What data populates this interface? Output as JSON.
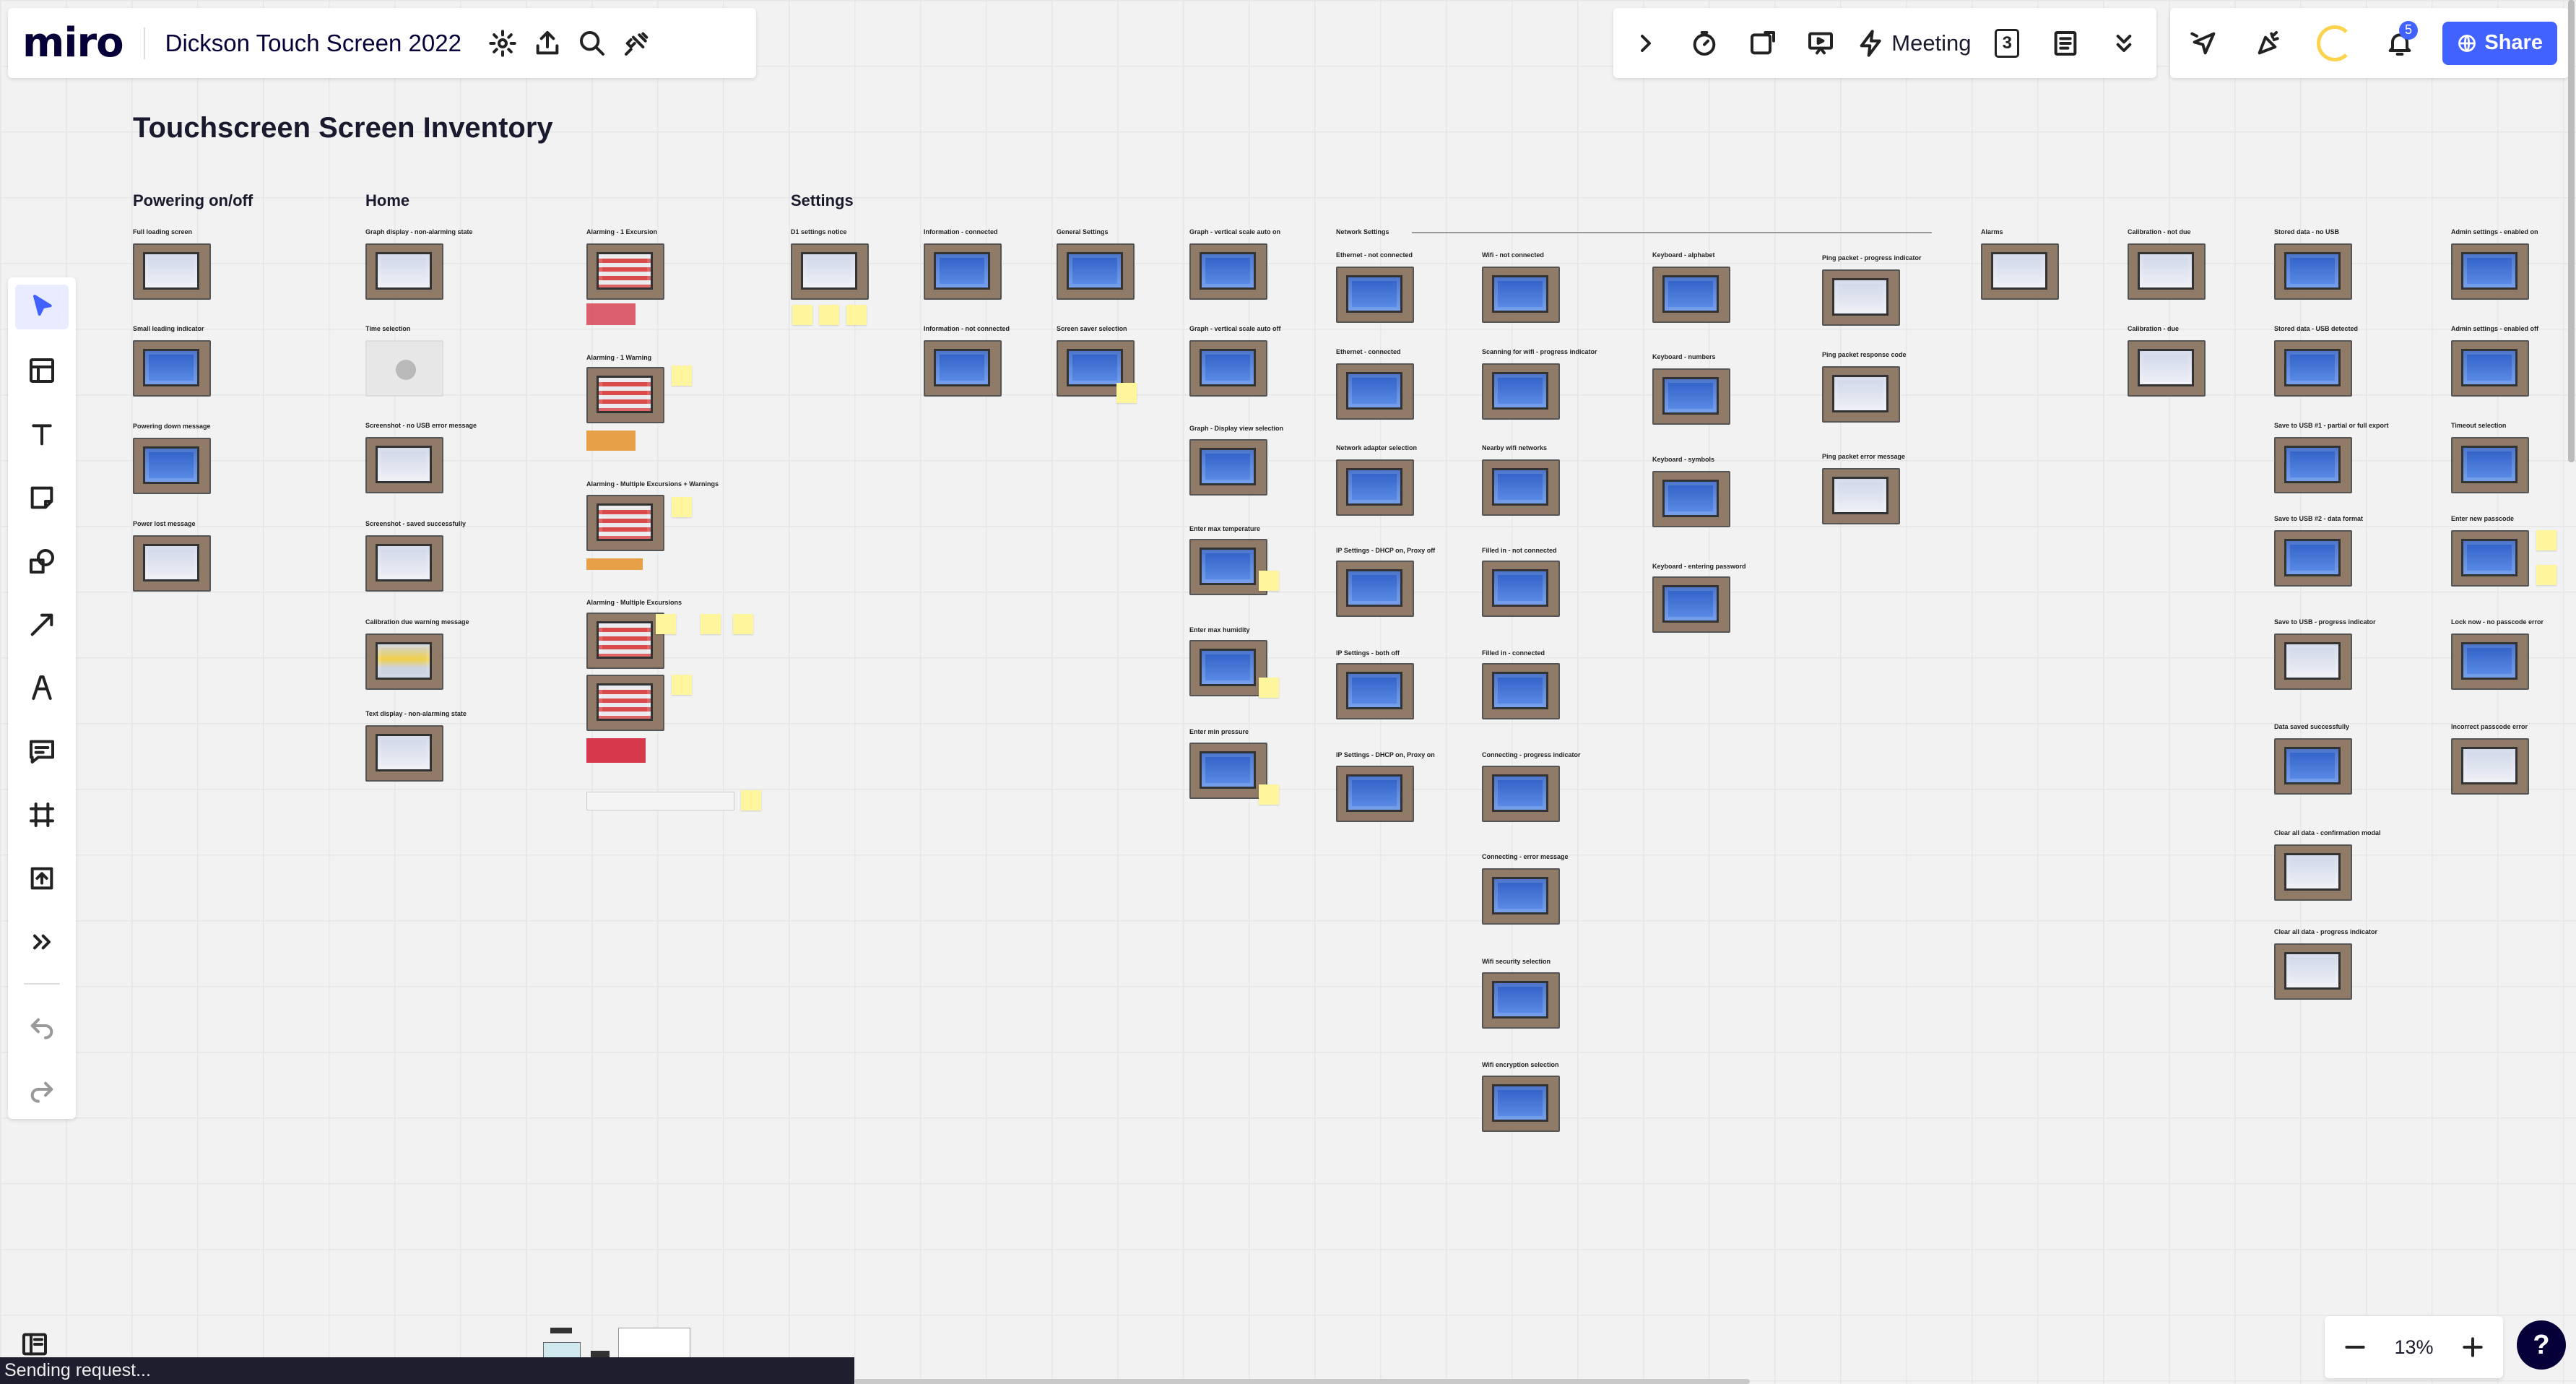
{
  "app": {
    "logo": "miro",
    "board_name": "Dickson Touch Screen 2022"
  },
  "top_toolbar": {
    "meeting_label": "Meeting",
    "page_count": "3",
    "share_label": "Share",
    "notifications": "5"
  },
  "zoom": {
    "value": "13%"
  },
  "status": "Sending request...",
  "board": {
    "title": "Touchscreen Screen Inventory",
    "sections": {
      "power": "Powering on/off",
      "home": "Home",
      "settings": "Settings"
    },
    "labels": {
      "full_loading": "Full loading screen",
      "small_loading": "Small leading indicator",
      "powering_down": "Powering down message",
      "power_lost": "Power lost message",
      "graph_nonalarm": "Graph display - non-alarming state",
      "time_selection": "Time selection",
      "screenshot_nousb": "Screenshot - no USB error message",
      "screenshot_saved": "Screenshot - saved successfully",
      "calib_warning": "Calibration due warning message",
      "text_display": "Text display - non-alarming state",
      "alarming_1exc": "Alarming - 1 Excursion",
      "alarming_1warn": "Alarming - 1 Warning",
      "alarming_multi_warn": "Alarming - Multiple Excursions + Warnings",
      "alarming_multi": "Alarming - Multiple Excursions",
      "d1_settings": "D1 settings notice",
      "info_connected": "Information - connected",
      "info_notconnected": "Information - not connected",
      "general_settings": "General Settings",
      "screen_saver": "Screen saver selection",
      "graph_vscale_on": "Graph - vertical scale auto on",
      "graph_vscale_off": "Graph - vertical scale auto off",
      "graph_display_view": "Graph - Display view selection",
      "enter_max_temp": "Enter max temperature",
      "enter_max_hum": "Enter max humidity",
      "enter_min_press": "Enter min pressure",
      "network_settings": "Network Settings",
      "eth_notconnected": "Ethernet - not connected",
      "eth_connected": "Ethernet - connected",
      "net_adapter": "Network adapter selection",
      "ip_dhcp_proxy_off": "IP Settings - DHCP on, Proxy off",
      "ip_both_off": "IP Settings - both off",
      "ip_dhcp_proxy_on": "IP Settings - DHCP on, Proxy on",
      "wifi_notconnected": "Wifi - not connected",
      "scanning_wifi": "Scanning for wifi - progress indicator",
      "nearby_wifi": "Nearby wifi networks",
      "filled_notconnected": "Filled in - not connected",
      "filled_connected": "Filled in - connected",
      "connecting_progress": "Connecting - progress indicator",
      "connecting_error": "Connecting - error message",
      "wifi_security": "Wifi security selection",
      "wifi_encryption": "Wifi encryption selection",
      "kb_alphabet": "Keyboard - alphabet",
      "kb_numbers": "Keyboard - numbers",
      "kb_symbols": "Keyboard - symbols",
      "kb_password": "Keyboard - entering password",
      "ping_progress": "Ping packet - progress indicator",
      "ping_response": "Ping packet response code",
      "ping_error": "Ping packet error message",
      "alarms": "Alarms",
      "calib_notdue": "Calibration - not due",
      "calib_due": "Calibration - due",
      "stored_nousb": "Stored data - no USB",
      "stored_usb": "Stored data - USB detected",
      "save_usb1": "Save to USB #1 - partial or full export",
      "save_usb2": "Save to USB #2 - data format",
      "save_usb_progress": "Save to USB - progress indicator",
      "data_saved": "Data saved successfully",
      "clear_confirm": "Clear all data - confirmation modal",
      "clear_progress": "Clear all data - progress indicator",
      "admin_on": "Admin settings - enabled on",
      "admin_off": "Admin settings - enabled off",
      "timeout_selection": "Timeout selection",
      "enter_passcode": "Enter new passcode",
      "lock_now": "Lock now - no passcode error",
      "incorrect_passcode": "Incorrect passcode error"
    }
  }
}
